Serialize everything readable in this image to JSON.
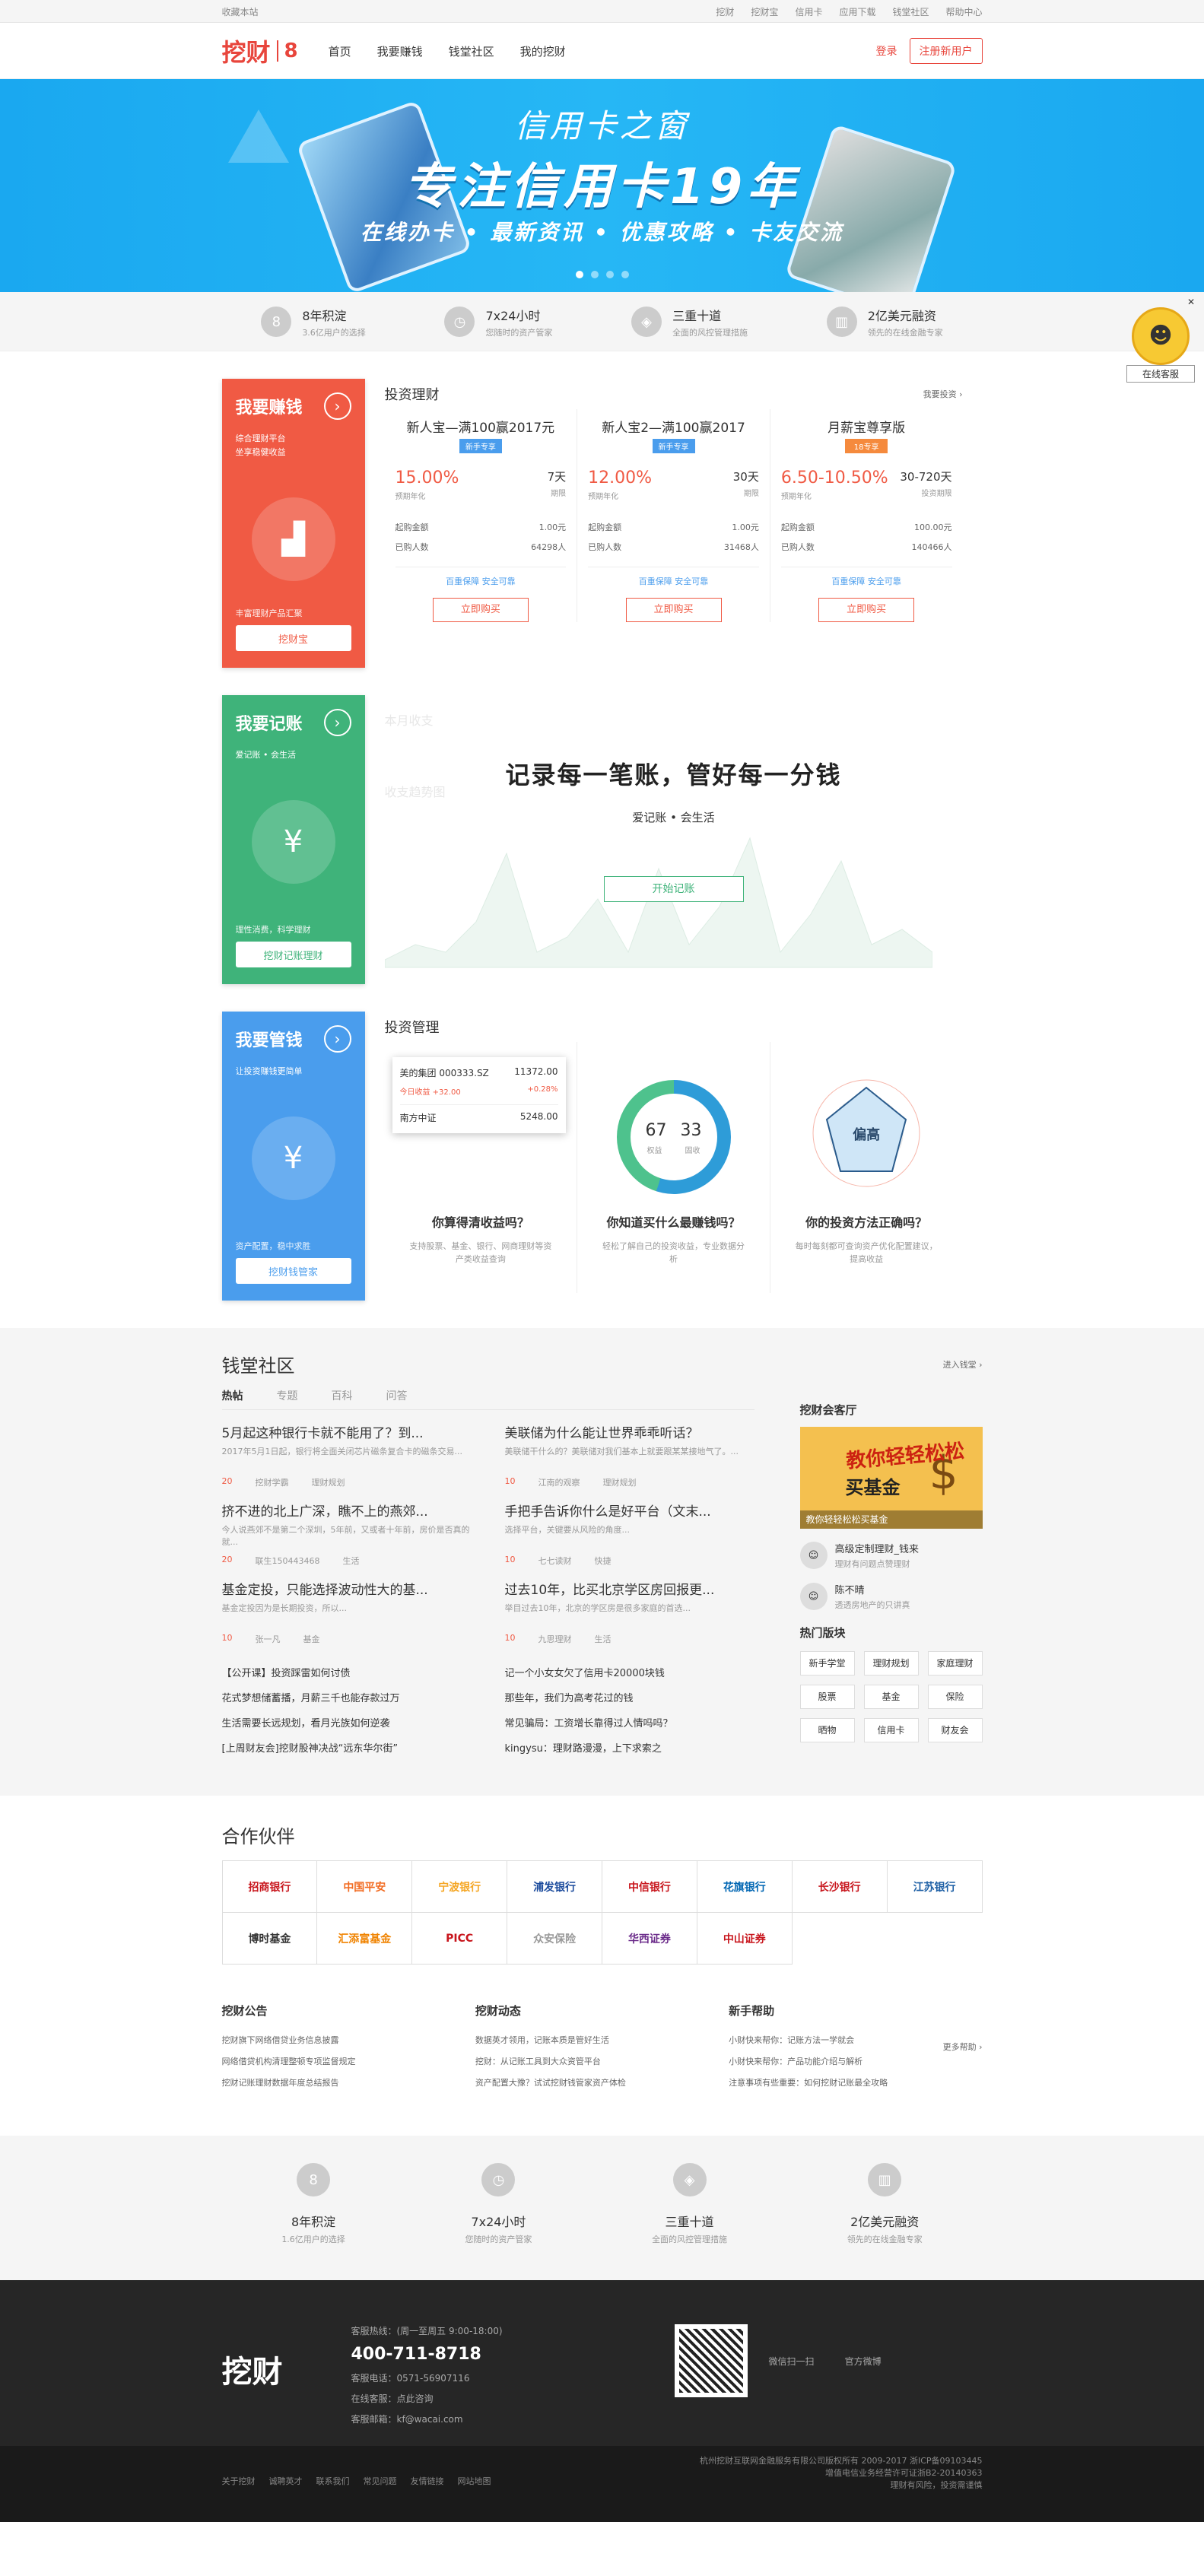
{
  "topbar": {
    "left": "收藏本站",
    "links": [
      "挖财",
      "挖财宝",
      "信用卡",
      "应用下载",
      "钱堂社区",
      "帮助中心"
    ]
  },
  "header": {
    "logo": "挖财",
    "year": "8",
    "nav": [
      "首页",
      "我要赚钱",
      "钱堂社区",
      "我的挖财"
    ],
    "login": "登录",
    "register": "注册新用户"
  },
  "banner": {
    "title": "信用卡之窗",
    "headline": "专注信用卡19年",
    "tagline": "在线办卡 • 最新资讯 • 优惠攻略 • 卡友交流"
  },
  "features": [
    {
      "icon": "8",
      "a": "8年积淀",
      "b": "3.6亿用户的选择"
    },
    {
      "icon": "◷",
      "a": "7x24小时",
      "b": "您随时的资产管家"
    },
    {
      "icon": "◈",
      "a": "三重十道",
      "b": "全面的风控管理措施"
    },
    {
      "icon": "▥",
      "a": "2亿美元融资",
      "b": "领先的在线金融专家"
    }
  ],
  "invest": {
    "side_title": "我要赚钱",
    "side_sub": "综合理财平台\n坐享稳健收益",
    "side_foot": "丰富理财产品汇聚",
    "side_btn": "挖财宝",
    "title": "投资理财",
    "more": "我要投资 ›",
    "products": [
      {
        "name": "新人宝—满100赢2017元",
        "tag": "新手专享",
        "rate": "15.00%",
        "rate_label": "预期年化",
        "days": "7天",
        "days_label": "期限",
        "min": "1.00元",
        "min_label": "起购金额",
        "count": "64298人",
        "count_label": "已购人数",
        "safe": "百重保障  安全可靠",
        "btn": "立即购买"
      },
      {
        "name": "新人宝2—满100赢2017",
        "tag": "新手专享",
        "rate": "12.00%",
        "rate_label": "预期年化",
        "days": "30天",
        "days_label": "期限",
        "min": "1.00元",
        "min_label": "起购金额",
        "count": "31468人",
        "count_label": "已购人数",
        "safe": "百重保障  安全可靠",
        "btn": "立即购买"
      },
      {
        "name": "月薪宝尊享版",
        "tag": "18专享",
        "rate": "6.50-10.50%",
        "rate_label": "预期年化",
        "days": "30-720天",
        "days_label": "投资期限",
        "min": "100.00元",
        "min_label": "起购金额",
        "count": "140466人",
        "count_label": "已购人数",
        "safe": "百重保障  安全可靠",
        "btn": "立即购买"
      }
    ]
  },
  "accounting": {
    "side_title": "我要记账",
    "side_sub": "爱记账 • 会生活",
    "side_foot": "理性消费，科学理财",
    "side_btn": "挖财记账理财",
    "headline": "记录每一笔账，管好每一分钱",
    "sub": "爱记账 • 会生活",
    "btn": "开始记账",
    "ghost_a": "本月收支",
    "ghost_b": "收支趋势图"
  },
  "manage": {
    "side_title": "我要管钱",
    "side_sub": "让投资赚钱更简单",
    "side_foot": "资产配置，稳中求胜",
    "side_btn": "挖财钱管家",
    "title": "投资管理",
    "stock": [
      {
        "n": "美的集团 000333.SZ",
        "v": "11372.00"
      },
      {
        "n": "今日收益 +32.00",
        "v": "+0.28%"
      },
      {
        "n": "南方中证",
        "v": "5248.00"
      }
    ],
    "donut": {
      "a": "67",
      "b": "33",
      "la": "权益",
      "lb": "固收"
    },
    "radar_label": "偏高",
    "items": [
      {
        "q": "你算得清收益吗？",
        "d": "支持股票、基金、银行、网商理财等资产类收益查询"
      },
      {
        "q": "你知道买什么最赚钱吗？",
        "d": "轻松了解自己的投资收益，专业数据分析"
      },
      {
        "q": "你的投资方法正确吗？",
        "d": "每时每刻都可查询资产优化配置建议，提高收益"
      }
    ]
  },
  "community": {
    "title": "钱堂社区",
    "more": "进入钱堂 ›",
    "tabs": [
      "热帖",
      "专题",
      "百科",
      "问答"
    ],
    "posts": [
      {
        "t": "5月起这种银行卡就不能用了？到...",
        "s": "2017年5月1日起，银行将全面关闭芯片磁条复合卡的磁条交易...",
        "c": "20",
        "u": "挖财学霸",
        "g": "理财规划"
      },
      {
        "t": "美联储为什么能让世界乖乖听话？",
        "s": "美联储干什么的？美联储对我们基本上就要跟某某接地气了。...",
        "c": "10",
        "u": "江南的观察",
        "g": "理财规划"
      },
      {
        "t": "挤不进的北上广深，瞧不上的燕郊...",
        "s": "今人说燕郊不是第二个深圳，5年前，又或者十年前，房价是否真的就...",
        "c": "20",
        "u": "联生150443468",
        "g": "生活"
      },
      {
        "t": "手把手告诉你什么是好平台（文末...",
        "s": "选择平台，关键要从风险的角度...",
        "c": "10",
        "u": "七七读财",
        "g": "快捷"
      },
      {
        "t": "基金定投，只能选择波动性大的基...",
        "s": "基金定投因为是长期投资，所以...",
        "c": "10",
        "u": "张一凡",
        "g": "基金"
      },
      {
        "t": "过去10年，比买北京学区房回报更...",
        "s": "举目过去10年，北京的学区房是很多家庭的首选...",
        "c": "10",
        "u": "九思理财",
        "g": "生活"
      }
    ],
    "links": [
      "【公开课】投资踩雷如何讨债",
      "记一个小女女欠了信用卡20000块钱",
      "花式梦想储蓄播，月薪三千也能存款过万",
      "那些年，我们为高考花过的钱",
      "生活需要长远规划，看月光族如何逆袭",
      "常见骗局：工资增长靠得过人情吗吗？",
      "[上周财友会]挖财股神决战“远东华尔街”",
      "kingysu：理财路漫漫，上下求索之"
    ],
    "hall": "挖财会客厅",
    "promo1": "教你轻轻松松",
    "promo2": "买基金",
    "promo3": "教你轻轻松松买基金",
    "users": [
      {
        "n": "高级定制理财_钱来",
        "d": "理财有问题点赞理财"
      },
      {
        "n": "陈不晴",
        "d": "透透房地产的只讲真"
      }
    ],
    "hot_title": "热门版块",
    "hot": [
      "新手学堂",
      "理财规划",
      "家庭理财",
      "股票",
      "基金",
      "保险",
      "晒物",
      "信用卡",
      "财友会"
    ]
  },
  "partners": {
    "title": "合作伙伴",
    "list": [
      "招商银行",
      "中国平安",
      "宁波银行",
      "浦发银行",
      "中信银行",
      "花旗银行",
      "长沙银行",
      "江苏银行",
      "博时基金",
      "汇添富基金",
      "PICC",
      "众安保险",
      "华西证券",
      "中山证券"
    ]
  },
  "news": {
    "more": "更多帮助 ›",
    "cols": [
      {
        "t": "挖财公告",
        "i": [
          "挖财旗下网络借贷业务信息披露",
          "网络借贷机构清理整顿专项监督规定",
          "挖财记账理财数据年度总结报告"
        ]
      },
      {
        "t": "挖财动态",
        "i": [
          "数据英才领用，记账本质是管好生活",
          "挖财：从记账工具到大众资管平台",
          "资产配置大豫？试试挖财钱管家资产体检"
        ]
      },
      {
        "t": "新手帮助",
        "i": [
          "小财快来帮你：记账方法一学就会",
          "小财快来帮你：产品功能介绍与解析",
          "注意事项有些重要：如何挖财记账最全攻略"
        ]
      }
    ]
  },
  "features2": [
    {
      "icon": "8",
      "a": "8年积淀",
      "b": "1.6亿用户的选择"
    },
    {
      "icon": "◷",
      "a": "7x24小时",
      "b": "您随时的资产管家"
    },
    {
      "icon": "◈",
      "a": "三重十道",
      "b": "全面的风控管理措施"
    },
    {
      "icon": "▥",
      "a": "2亿美元融资",
      "b": "领先的在线金融专家"
    }
  ],
  "footer": {
    "logo": "挖财",
    "hotline_label": "客服热线：(周一至周五 9:00-18:00)",
    "phone": "400-711-8718",
    "tel": "客服电话：0571-56907116",
    "online": "在线客服：点此咨询",
    "mail": "客服邮箱：kf@wacai.com",
    "weixin": "微信扫一扫",
    "weibo": "官方微博",
    "links": [
      "关于挖财",
      "诚聘英才",
      "联系我们",
      "常见问题",
      "友情链接",
      "网站地图"
    ],
    "copy1": "杭州挖财互联网金融服务有限公司版权所有   2009-2017 浙ICP备09103445",
    "copy2": "增值电信业务经营许可证浙B2-20140363",
    "copy3": "理财有风险，投资需谨慎"
  },
  "service": "在线客服"
}
